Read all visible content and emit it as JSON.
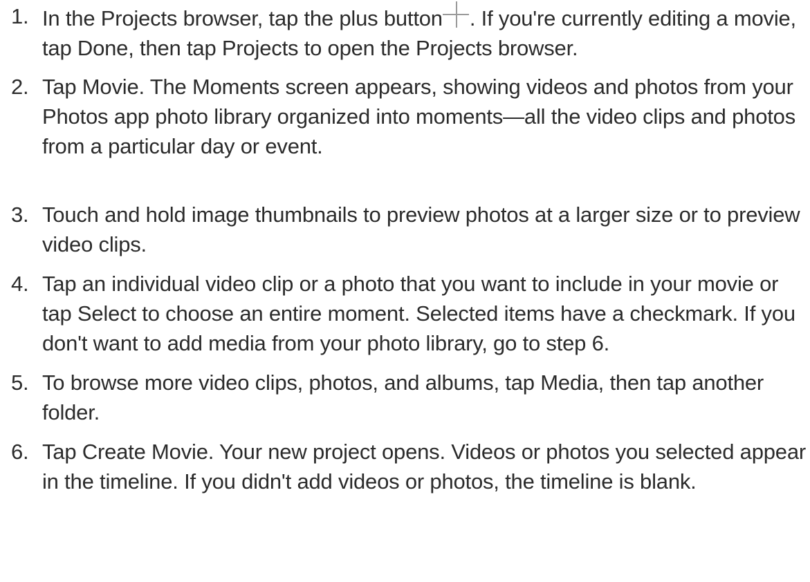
{
  "steps": [
    {
      "number": "1.",
      "before_icon": "In the Projects browser, tap the plus button",
      "icon": "plus-icon",
      "after_icon": ". If you're currently editing a movie, tap Done, then tap Projects to open the Projects browser."
    },
    {
      "number": "2.",
      "text": "Tap Movie. The Moments screen appears, showing videos and photos from your Photos app photo library organized into moments—all the video clips and photos from a particular day or event."
    },
    {
      "number": "3.",
      "text": "Touch and hold image thumbnails to preview photos at a larger size or to preview video clips."
    },
    {
      "number": "4.",
      "text": "Tap an individual video clip or a photo that you want to include in your movie or tap Select to choose an entire moment. Selected items have a checkmark. If you don't want to add media from your photo library, go to step 6."
    },
    {
      "number": "5.",
      "text": "To browse more video clips, photos, and albums, tap Media, then tap another folder."
    },
    {
      "number": "6.",
      "text": "Tap Create Movie. Your new project opens. Videos or photos you selected appear in the timeline. If you didn't add videos or photos, the timeline is blank."
    }
  ]
}
